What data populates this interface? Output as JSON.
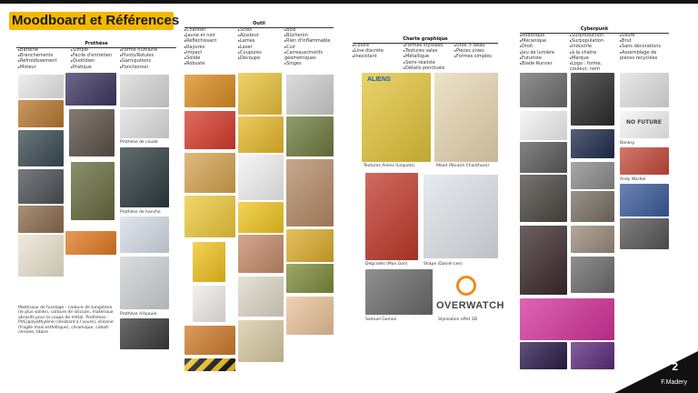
{
  "title": "Moodboard et Références",
  "page_number": "2",
  "author": "F.Madery",
  "colors": {
    "accent": "#f5b800",
    "dark": "#111111"
  },
  "sections": {
    "prothese": {
      "title": "Prothèse",
      "col1": [
        "Batterie",
        "Branchements",
        "Refroidissement",
        "Moteur"
      ],
      "col2": [
        "Simple",
        "Facile d'entretien",
        "Quotidien",
        "Pratique"
      ],
      "col3": [
        "Forme humaine",
        "Pivots/Rotules",
        "Garniputions",
        "Fonctionnel"
      ],
      "captions": [
        "Prothèse de coude",
        "Prothèse de hanche",
        "Prothèse d'épaule"
      ],
      "note": "Matériaux de fuselage : carbure de tungstène (le plus solide), carbure de silicium, matériaux abrasifs pour la coupe de métal. Prothèses : PVC/polyéthylène (résistant à l'usure), silicone (fragile mais esthétique), céramique, cobalt-chrome, titane"
    },
    "outil": {
      "title": "Outil",
      "col1": [
        "Chantier",
        "Jaune et noir",
        "Réfléchissant",
        "Rayures",
        "Impact",
        "Solide",
        "Robuste"
      ],
      "col2": [
        "Scies",
        "Ajusteur",
        "Lames",
        "Laser",
        "Coupures",
        "Découpe"
      ],
      "col3": [
        "Bois",
        "Bûcheron",
        "Rien d'inflammable",
        "Cuir",
        "Carreaux/motifs géométriques",
        "Singes"
      ]
    },
    "charte": {
      "title": "Charte graphique",
      "col1": [
        "Colore",
        "Line discrète",
        "Inexistant"
      ],
      "col2": [
        "Formes stylisées",
        "Textures sales",
        "Métallique",
        "Semi-réaliste",
        "Détails ponctuels"
      ],
      "col3": [
        "Utile > beau",
        "Pièces unies",
        "Formes simples"
      ],
      "captions": [
        "Textures Aliens (Loquets)",
        "Mood (Nivanh Chanthara)",
        "Dégradés (Max Gon)",
        "Shape (Daniel Lee)",
        "Samuel Gomez",
        "Stylisation effet 3D"
      ],
      "aliens_text": "ALIENS",
      "overwatch_text": "OVERWATCH"
    },
    "cyberpunk": {
      "title": "Cyberpunk",
      "col1": [
        "Robotique",
        "Mécanique",
        "Droit",
        "Jeu de lumière",
        "Futuriste",
        "Blade Runner"
      ],
      "col2": [
        "Surproduction",
        "Surpopulation",
        "Industrie",
        "à la chaîne",
        "Marque",
        "Logo : forme, couleur, nom"
      ],
      "col3": [
        "Usure",
        "Brut",
        "Sans décorations",
        "Assemblage de pièces recyclées"
      ],
      "captions": [
        "Banksy",
        "Andy Warhol"
      ],
      "graffiti_text": "NO FUTURE"
    }
  }
}
